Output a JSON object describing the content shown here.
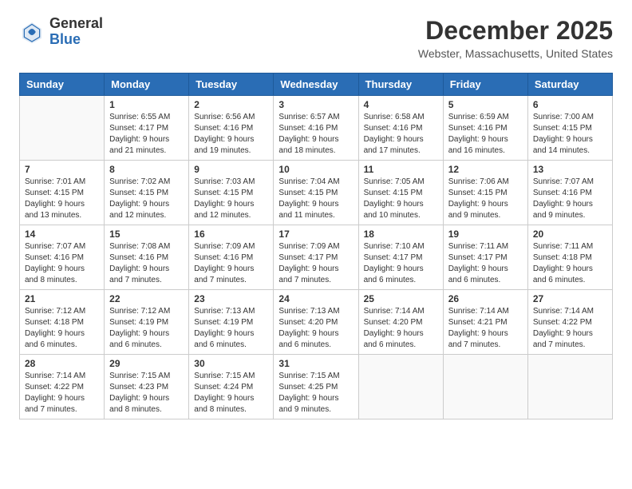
{
  "header": {
    "logo_general": "General",
    "logo_blue": "Blue",
    "month_year": "December 2025",
    "location": "Webster, Massachusetts, United States"
  },
  "weekdays": [
    "Sunday",
    "Monday",
    "Tuesday",
    "Wednesday",
    "Thursday",
    "Friday",
    "Saturday"
  ],
  "weeks": [
    [
      {
        "day": null,
        "sunrise": null,
        "sunset": null,
        "daylight": null
      },
      {
        "day": "1",
        "sunrise": "Sunrise: 6:55 AM",
        "sunset": "Sunset: 4:17 PM",
        "daylight": "Daylight: 9 hours and 21 minutes."
      },
      {
        "day": "2",
        "sunrise": "Sunrise: 6:56 AM",
        "sunset": "Sunset: 4:16 PM",
        "daylight": "Daylight: 9 hours and 19 minutes."
      },
      {
        "day": "3",
        "sunrise": "Sunrise: 6:57 AM",
        "sunset": "Sunset: 4:16 PM",
        "daylight": "Daylight: 9 hours and 18 minutes."
      },
      {
        "day": "4",
        "sunrise": "Sunrise: 6:58 AM",
        "sunset": "Sunset: 4:16 PM",
        "daylight": "Daylight: 9 hours and 17 minutes."
      },
      {
        "day": "5",
        "sunrise": "Sunrise: 6:59 AM",
        "sunset": "Sunset: 4:16 PM",
        "daylight": "Daylight: 9 hours and 16 minutes."
      },
      {
        "day": "6",
        "sunrise": "Sunrise: 7:00 AM",
        "sunset": "Sunset: 4:15 PM",
        "daylight": "Daylight: 9 hours and 14 minutes."
      }
    ],
    [
      {
        "day": "7",
        "sunrise": "Sunrise: 7:01 AM",
        "sunset": "Sunset: 4:15 PM",
        "daylight": "Daylight: 9 hours and 13 minutes."
      },
      {
        "day": "8",
        "sunrise": "Sunrise: 7:02 AM",
        "sunset": "Sunset: 4:15 PM",
        "daylight": "Daylight: 9 hours and 12 minutes."
      },
      {
        "day": "9",
        "sunrise": "Sunrise: 7:03 AM",
        "sunset": "Sunset: 4:15 PM",
        "daylight": "Daylight: 9 hours and 12 minutes."
      },
      {
        "day": "10",
        "sunrise": "Sunrise: 7:04 AM",
        "sunset": "Sunset: 4:15 PM",
        "daylight": "Daylight: 9 hours and 11 minutes."
      },
      {
        "day": "11",
        "sunrise": "Sunrise: 7:05 AM",
        "sunset": "Sunset: 4:15 PM",
        "daylight": "Daylight: 9 hours and 10 minutes."
      },
      {
        "day": "12",
        "sunrise": "Sunrise: 7:06 AM",
        "sunset": "Sunset: 4:15 PM",
        "daylight": "Daylight: 9 hours and 9 minutes."
      },
      {
        "day": "13",
        "sunrise": "Sunrise: 7:07 AM",
        "sunset": "Sunset: 4:16 PM",
        "daylight": "Daylight: 9 hours and 9 minutes."
      }
    ],
    [
      {
        "day": "14",
        "sunrise": "Sunrise: 7:07 AM",
        "sunset": "Sunset: 4:16 PM",
        "daylight": "Daylight: 9 hours and 8 minutes."
      },
      {
        "day": "15",
        "sunrise": "Sunrise: 7:08 AM",
        "sunset": "Sunset: 4:16 PM",
        "daylight": "Daylight: 9 hours and 7 minutes."
      },
      {
        "day": "16",
        "sunrise": "Sunrise: 7:09 AM",
        "sunset": "Sunset: 4:16 PM",
        "daylight": "Daylight: 9 hours and 7 minutes."
      },
      {
        "day": "17",
        "sunrise": "Sunrise: 7:09 AM",
        "sunset": "Sunset: 4:17 PM",
        "daylight": "Daylight: 9 hours and 7 minutes."
      },
      {
        "day": "18",
        "sunrise": "Sunrise: 7:10 AM",
        "sunset": "Sunset: 4:17 PM",
        "daylight": "Daylight: 9 hours and 6 minutes."
      },
      {
        "day": "19",
        "sunrise": "Sunrise: 7:11 AM",
        "sunset": "Sunset: 4:17 PM",
        "daylight": "Daylight: 9 hours and 6 minutes."
      },
      {
        "day": "20",
        "sunrise": "Sunrise: 7:11 AM",
        "sunset": "Sunset: 4:18 PM",
        "daylight": "Daylight: 9 hours and 6 minutes."
      }
    ],
    [
      {
        "day": "21",
        "sunrise": "Sunrise: 7:12 AM",
        "sunset": "Sunset: 4:18 PM",
        "daylight": "Daylight: 9 hours and 6 minutes."
      },
      {
        "day": "22",
        "sunrise": "Sunrise: 7:12 AM",
        "sunset": "Sunset: 4:19 PM",
        "daylight": "Daylight: 9 hours and 6 minutes."
      },
      {
        "day": "23",
        "sunrise": "Sunrise: 7:13 AM",
        "sunset": "Sunset: 4:19 PM",
        "daylight": "Daylight: 9 hours and 6 minutes."
      },
      {
        "day": "24",
        "sunrise": "Sunrise: 7:13 AM",
        "sunset": "Sunset: 4:20 PM",
        "daylight": "Daylight: 9 hours and 6 minutes."
      },
      {
        "day": "25",
        "sunrise": "Sunrise: 7:14 AM",
        "sunset": "Sunset: 4:20 PM",
        "daylight": "Daylight: 9 hours and 6 minutes."
      },
      {
        "day": "26",
        "sunrise": "Sunrise: 7:14 AM",
        "sunset": "Sunset: 4:21 PM",
        "daylight": "Daylight: 9 hours and 7 minutes."
      },
      {
        "day": "27",
        "sunrise": "Sunrise: 7:14 AM",
        "sunset": "Sunset: 4:22 PM",
        "daylight": "Daylight: 9 hours and 7 minutes."
      }
    ],
    [
      {
        "day": "28",
        "sunrise": "Sunrise: 7:14 AM",
        "sunset": "Sunset: 4:22 PM",
        "daylight": "Daylight: 9 hours and 7 minutes."
      },
      {
        "day": "29",
        "sunrise": "Sunrise: 7:15 AM",
        "sunset": "Sunset: 4:23 PM",
        "daylight": "Daylight: 9 hours and 8 minutes."
      },
      {
        "day": "30",
        "sunrise": "Sunrise: 7:15 AM",
        "sunset": "Sunset: 4:24 PM",
        "daylight": "Daylight: 9 hours and 8 minutes."
      },
      {
        "day": "31",
        "sunrise": "Sunrise: 7:15 AM",
        "sunset": "Sunset: 4:25 PM",
        "daylight": "Daylight: 9 hours and 9 minutes."
      },
      {
        "day": null,
        "sunrise": null,
        "sunset": null,
        "daylight": null
      },
      {
        "day": null,
        "sunrise": null,
        "sunset": null,
        "daylight": null
      },
      {
        "day": null,
        "sunrise": null,
        "sunset": null,
        "daylight": null
      }
    ]
  ]
}
